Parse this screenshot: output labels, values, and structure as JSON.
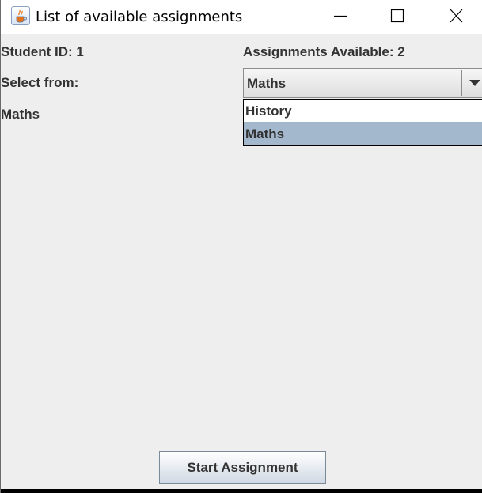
{
  "window": {
    "title": "List of available assignments",
    "icon": "java-cup-icon",
    "controls": [
      "minimize-icon",
      "maximize-icon",
      "close-icon"
    ]
  },
  "form": {
    "student_id_label": "Student ID: 1",
    "assignments_available_label": "Assignments Available: 2",
    "select_from_label": "Select from:",
    "selected_assignment_text": "Maths"
  },
  "combo": {
    "value": "Maths",
    "arrow_icon": "dropdown-arrow-icon",
    "options": [
      {
        "label": "History",
        "selected": false
      },
      {
        "label": "Maths",
        "selected": true
      }
    ]
  },
  "actions": {
    "start_label": "Start Assignment"
  },
  "colors": {
    "window_bg": "#eeeeee",
    "titlebar_bg": "#ffffff",
    "selection_bg": "#a3b8cc",
    "text": "#333333"
  }
}
